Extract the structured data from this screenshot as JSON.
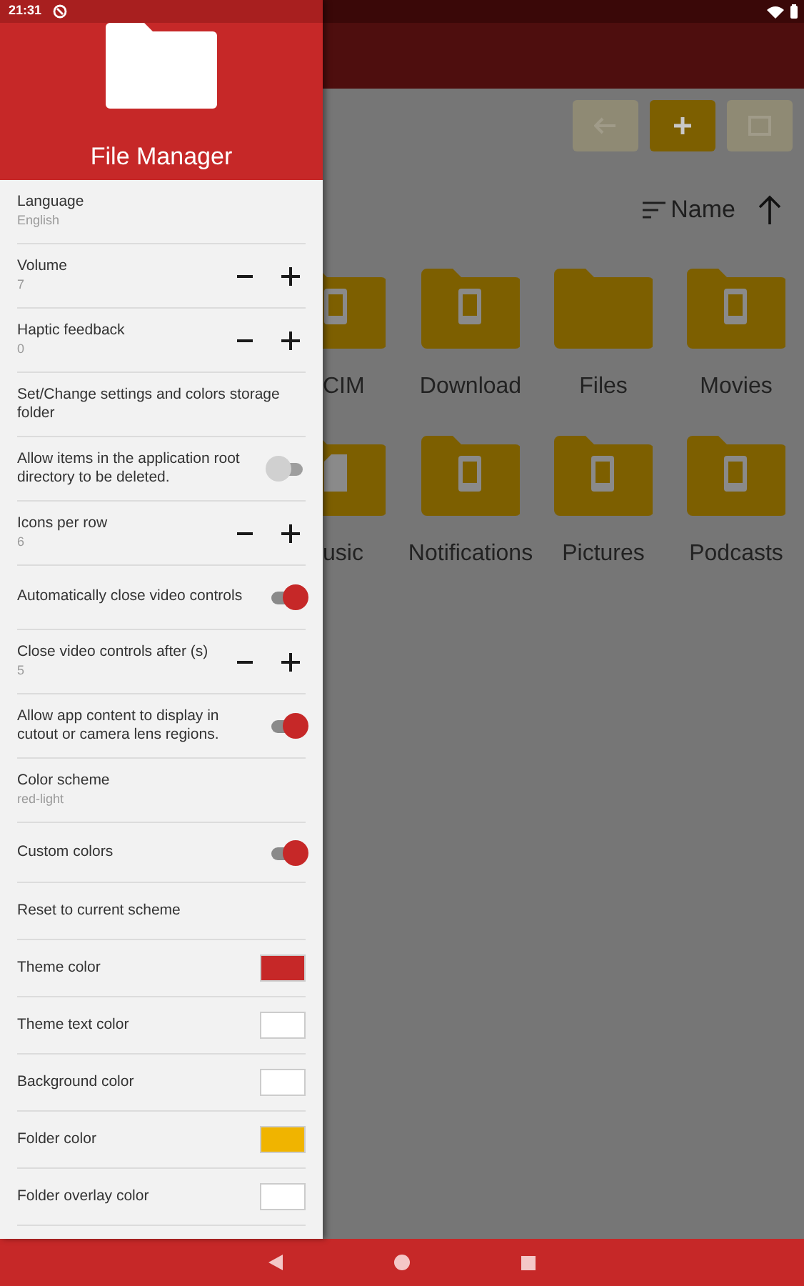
{
  "status_bar": {
    "time": "21:31"
  },
  "drawer": {
    "title": "File Manager",
    "settings": [
      {
        "kind": "value",
        "label": "Language",
        "value": "English"
      },
      {
        "kind": "stepper",
        "label": "Volume",
        "value": "7"
      },
      {
        "kind": "stepper",
        "label": "Haptic feedback",
        "value": "0"
      },
      {
        "kind": "action",
        "label": "Set/Change settings and colors storage folder"
      },
      {
        "kind": "toggle",
        "label": "Allow items in the application root directory to be deleted.",
        "on": false
      },
      {
        "kind": "stepper",
        "label": "Icons per row",
        "value": "6"
      },
      {
        "kind": "toggle",
        "label": "Automatically close video controls",
        "on": true
      },
      {
        "kind": "stepper",
        "label": "Close video controls after (s)",
        "value": "5"
      },
      {
        "kind": "toggle",
        "label": "Allow app content to display in cutout or camera lens regions.",
        "on": true
      },
      {
        "kind": "value",
        "label": "Color scheme",
        "value": "red-light"
      },
      {
        "kind": "toggle",
        "label": "Custom colors",
        "on": true
      },
      {
        "kind": "action",
        "label": "Reset to current scheme"
      },
      {
        "kind": "color",
        "label": "Theme color",
        "color": "#c62828"
      },
      {
        "kind": "color",
        "label": "Theme text color",
        "color": "#ffffff"
      },
      {
        "kind": "color",
        "label": "Background color",
        "color": "#ffffff"
      },
      {
        "kind": "color",
        "label": "Folder color",
        "color": "#f0b400"
      },
      {
        "kind": "color",
        "label": "Folder overlay color",
        "color": "#ffffff"
      }
    ]
  },
  "toolbar": {
    "buttons": [
      {
        "kind": "back",
        "disabled": true
      },
      {
        "kind": "new-folder",
        "disabled": false
      },
      {
        "kind": "select",
        "disabled": true
      }
    ]
  },
  "sort": {
    "label": "Name"
  },
  "folders": [
    {
      "label": "CIM",
      "kind": "device",
      "cut": true
    },
    {
      "label": "Download",
      "kind": "device",
      "cut": false
    },
    {
      "label": "Files",
      "kind": "plain",
      "cut": false
    },
    {
      "label": "Movies",
      "kind": "device",
      "cut": false
    },
    {
      "label": "usic",
      "kind": "card",
      "cut": true
    },
    {
      "label": "Notifications",
      "kind": "device",
      "cut": false
    },
    {
      "label": "Pictures",
      "kind": "device",
      "cut": false
    },
    {
      "label": "Podcasts",
      "kind": "device",
      "cut": false
    }
  ]
}
